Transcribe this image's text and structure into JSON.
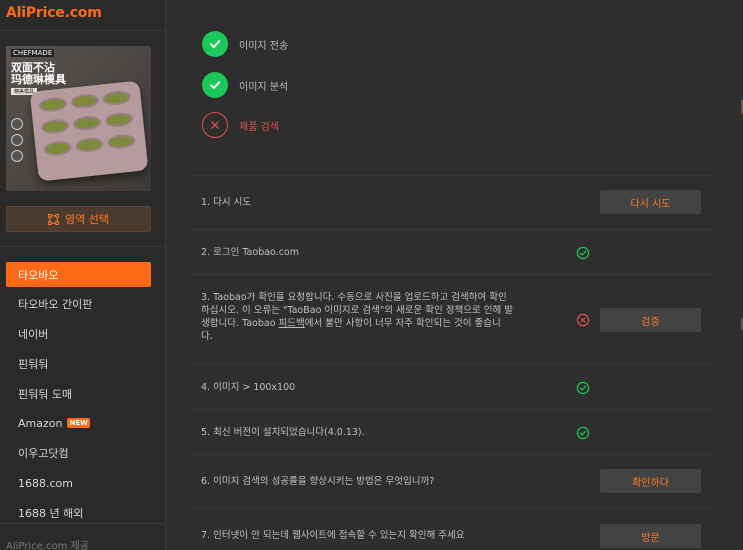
{
  "app": {
    "logo": "AliPrice.com"
  },
  "sidebar": {
    "thumbnail": {
      "brand": "CHEFMADE",
      "title_line1": "双面不沾",
      "title_line2": "玛德琳模具",
      "subtitle": "精美模具"
    },
    "area_button": "영역 선택",
    "items": [
      {
        "label": "타오바오",
        "active": true
      },
      {
        "label": "타오바오 간이판"
      },
      {
        "label": "네이버"
      },
      {
        "label": "핀둬둬"
      },
      {
        "label": "핀둬둬 도매"
      },
      {
        "label": "Amazon",
        "badge": "NEW"
      },
      {
        "label": "이우고닷컴"
      },
      {
        "label": "1688.com"
      },
      {
        "label": "1688 년 해외"
      }
    ],
    "footer": "AliPrice.com 제공"
  },
  "steps": [
    {
      "label": "이미지 전송",
      "status": "ok"
    },
    {
      "label": "이미지 분석",
      "status": "ok"
    },
    {
      "label": "제품 검색",
      "status": "fail"
    }
  ],
  "checklist": {
    "row1": {
      "text": "1. 다시 시도",
      "action": "다시 시도"
    },
    "row2": {
      "text": "2. 로그인 Taobao.com",
      "status": "ok"
    },
    "row3": {
      "line1": "3. Taobao가 확인을 요청합니다. 수동으로 사진을 업로드하고 검색하여 확인",
      "line2": "하십시오. 이 오류는 \"TaoBao 이미지로 검색\"의 새로운 확인 정책으로 인해 발",
      "line3_pre": "생합니다. Taobao ",
      "line3_link": "피드백",
      "line3_post": "에서 불만 사항이 너무 자주 확인되는 것이 좋습니",
      "line4": "다.",
      "status": "fail",
      "action": "검증"
    },
    "row4": {
      "text": "4. 이미지 > 100x100",
      "status": "ok"
    },
    "row5": {
      "text": "5. 최신 버전이 설치되었습니다(4.0.13).",
      "status": "ok"
    },
    "row6": {
      "text": "6. 이미지 검색의 성공률을 향상시키는 방법은 무엇입니까?",
      "action": "확인하다"
    },
    "row7": {
      "text": "7. 인터넷이 안 되는데 웹사이트에 접속할 수 있는지 확인해 주세요",
      "action": "방문"
    }
  },
  "colors": {
    "accent": "#ff6a14",
    "success": "#1cc85a",
    "error": "#e0504c",
    "background": "#2e2e2e"
  }
}
